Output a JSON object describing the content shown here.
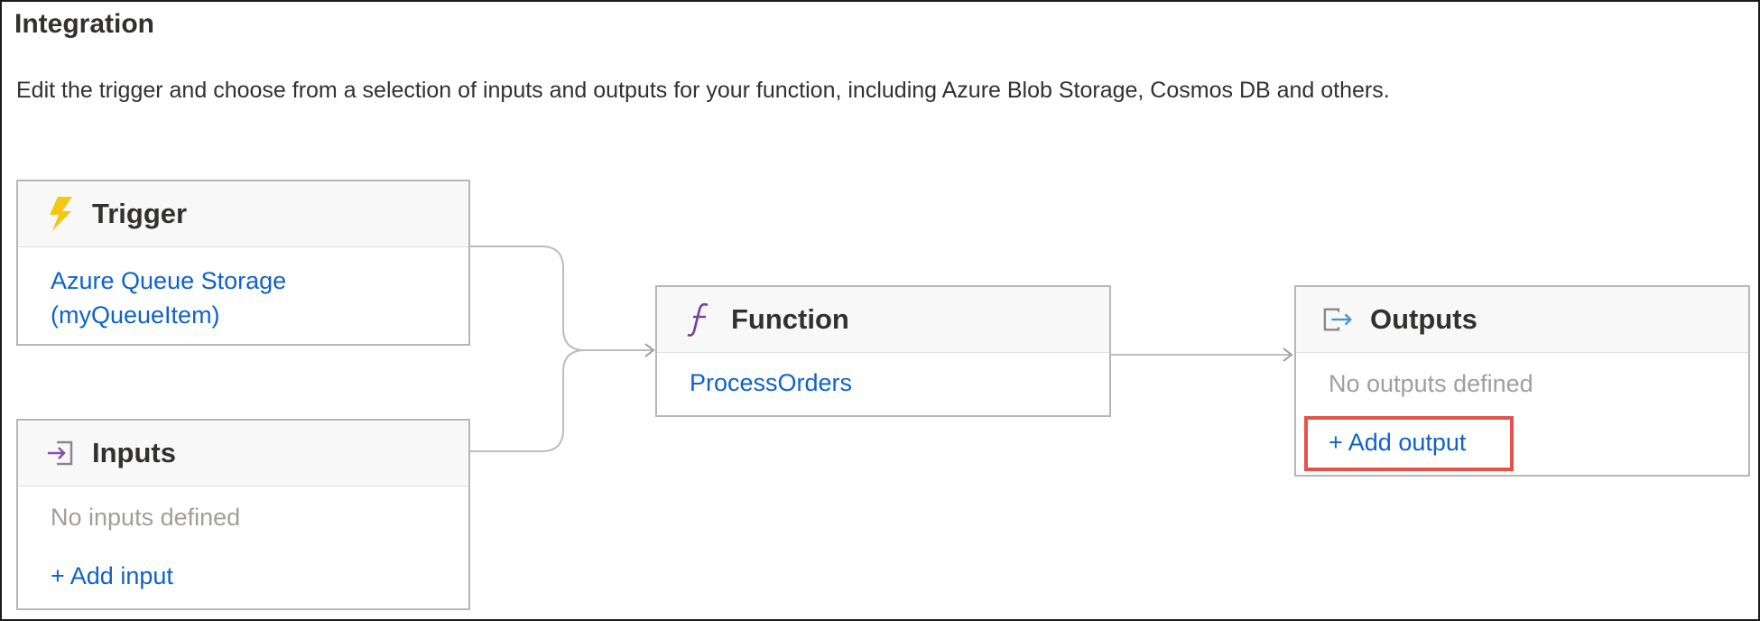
{
  "page": {
    "title": "Integration",
    "description": "Edit the trigger and choose from a selection of inputs and outputs for your function, including Azure Blob Storage, Cosmos DB and others."
  },
  "trigger": {
    "title": "Trigger",
    "icon": "lightning-bolt-icon",
    "binding_line1": "Azure Queue Storage",
    "binding_line2": "(myQueueItem)"
  },
  "inputs": {
    "title": "Inputs",
    "icon": "input-arrow-icon",
    "empty_text": "No inputs defined",
    "add_label": "+ Add input"
  },
  "function": {
    "title": "Function",
    "icon": "function-f-icon",
    "name": "ProcessOrders"
  },
  "outputs": {
    "title": "Outputs",
    "icon": "output-arrow-icon",
    "empty_text": "No outputs defined",
    "add_label": "+ Add output"
  },
  "colors": {
    "link": "#0f62cc",
    "highlight": "#e4524a",
    "bolt": "#f2c811",
    "function_icon": "#7a3e9d"
  }
}
